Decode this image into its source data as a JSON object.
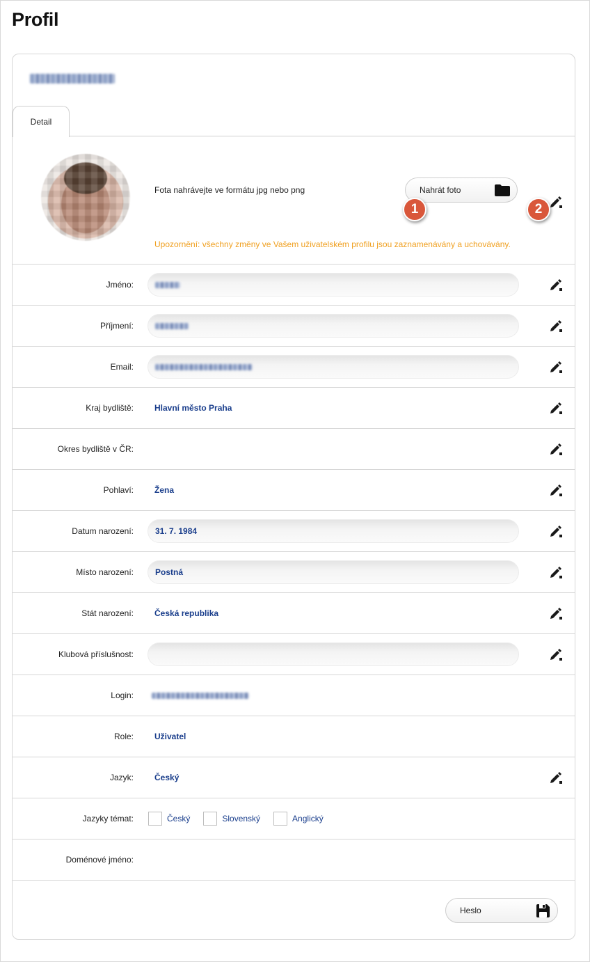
{
  "page": {
    "title": "Profil"
  },
  "tabs": [
    {
      "label": "Detail",
      "active": true
    }
  ],
  "photo": {
    "hint": "Fota nahrávejte ve formátu jpg nebo png",
    "upload_label": "Nahrát foto",
    "warning": "Upozornění: všechny změny ve Vašem uživatelském profilu jsou zaznamenávány a uchovávány.",
    "badges": [
      "1",
      "2"
    ]
  },
  "fields": {
    "jmeno": {
      "label": "Jméno:"
    },
    "prijmeni": {
      "label": "Příjmení:"
    },
    "email": {
      "label": "Email:"
    },
    "kraj": {
      "label": "Kraj bydliště:",
      "value": "Hlavní město Praha"
    },
    "okres": {
      "label": "Okres bydliště v ČR:",
      "value": ""
    },
    "pohlavi": {
      "label": "Pohlaví:",
      "value": "Žena"
    },
    "datum": {
      "label": "Datum narození:",
      "value": "31. 7. 1984"
    },
    "misto": {
      "label": "Místo narození:",
      "value": "Postná"
    },
    "stat": {
      "label": "Stát narození:",
      "value": "Česká republika"
    },
    "klub": {
      "label": "Klubová příslušnost:",
      "value": ""
    },
    "login": {
      "label": "Login:"
    },
    "role": {
      "label": "Role:",
      "value": "Uživatel"
    },
    "jazyk": {
      "label": "Jazyk:",
      "value": "Český"
    },
    "jazyky_temat": {
      "label": "Jazyky témat:",
      "options": [
        "Český",
        "Slovenský",
        "Anglický"
      ]
    },
    "domena": {
      "label": "Doménové jméno:",
      "value": ""
    }
  },
  "password_button": {
    "label": "Heslo"
  },
  "colors": {
    "value_text": "#1a3e8c",
    "warning": "#f0a020",
    "badge": "#d9573b"
  },
  "icons": {
    "edit": "pencil-icon",
    "upload": "folder-icon",
    "password": "floppy-disk-icon"
  }
}
